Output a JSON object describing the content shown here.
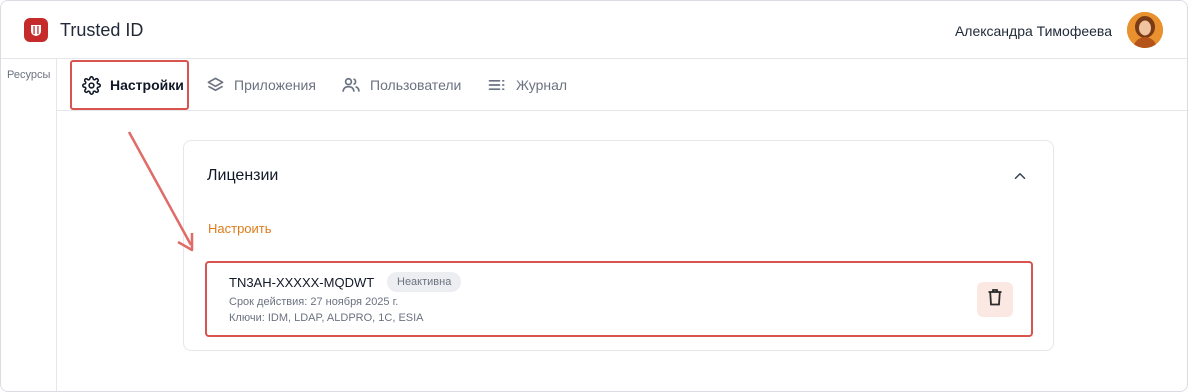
{
  "header": {
    "app_title": "Trusted ID",
    "user_name": "Александра Тимофеева",
    "icons": {
      "logo": "trusted-id-logo",
      "avatar": "user-avatar"
    }
  },
  "sidebar": {
    "label": "Ресурсы"
  },
  "tabs": [
    {
      "label": "Настройки",
      "icon": "gear-icon",
      "active": true
    },
    {
      "label": "Приложения",
      "icon": "layers-icon",
      "active": false
    },
    {
      "label": "Пользователи",
      "icon": "users-icon",
      "active": false
    },
    {
      "label": "Журнал",
      "icon": "list-icon",
      "active": false
    }
  ],
  "licenses": {
    "title": "Лицензии",
    "configure_label": "Настроить",
    "items": [
      {
        "key": "TN3AH-XXXXX-MQDWT",
        "status": "Неактивна",
        "validity": "Срок действия: 27 ноября 2025 г.",
        "keys": "Ключи: IDM, LDAP, ALDPRO, 1C,  ESIA"
      }
    ]
  },
  "colors": {
    "accent": "#e07b1a",
    "highlight": "#d9534f",
    "logo": "#c62b2b",
    "delete_bg": "#fce8e2"
  }
}
